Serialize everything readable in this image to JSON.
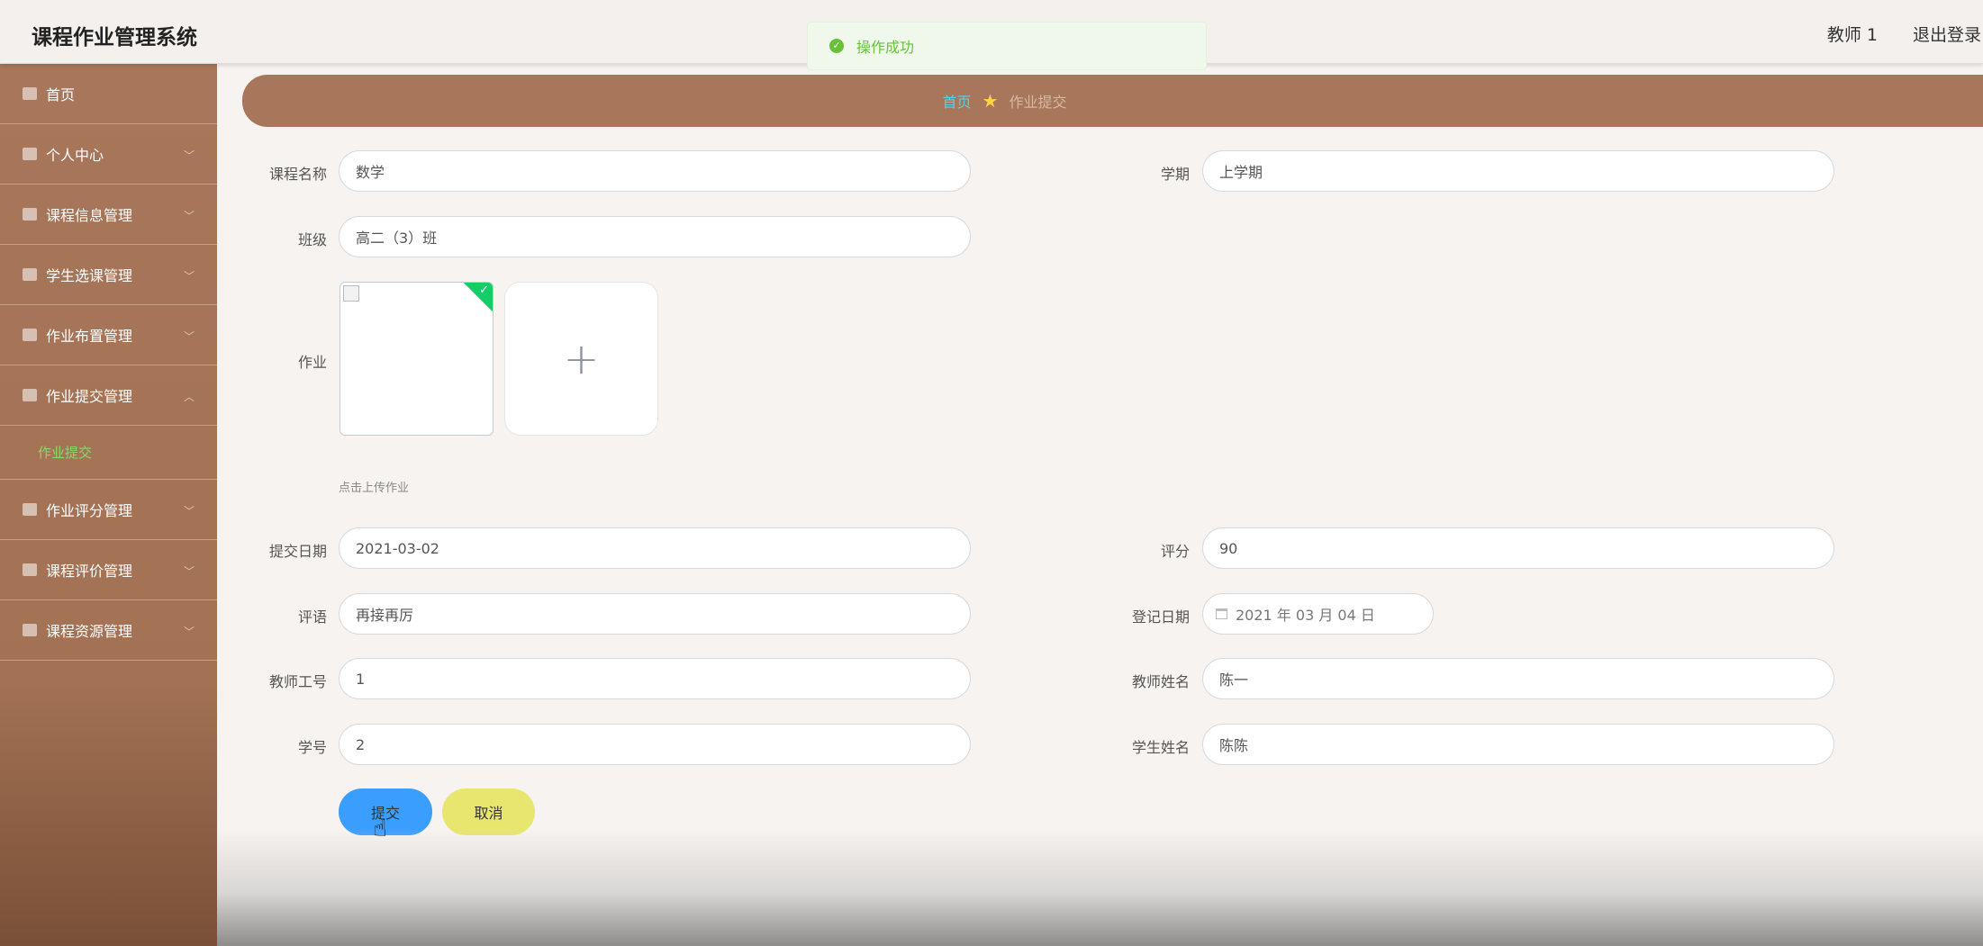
{
  "header": {
    "app_title": "课程作业管理系统",
    "user": "教师 1",
    "logout": "退出登录"
  },
  "toast": {
    "message": "操作成功"
  },
  "sidebar": {
    "items": [
      {
        "label": "首页",
        "icon": "home-icon",
        "expanded": false
      },
      {
        "label": "个人中心",
        "icon": "user-icon",
        "expanded": false
      },
      {
        "label": "课程信息管理",
        "icon": "monitor-icon",
        "expanded": false
      },
      {
        "label": "学生选课管理",
        "icon": "briefcase-icon",
        "expanded": false
      },
      {
        "label": "作业布置管理",
        "icon": "grid-icon",
        "expanded": false
      },
      {
        "label": "作业提交管理",
        "icon": "clipboard-icon",
        "expanded": true
      },
      {
        "label": "作业评分管理",
        "icon": "copy-icon",
        "expanded": false
      },
      {
        "label": "课程评价管理",
        "icon": "clipboard-icon",
        "expanded": false
      },
      {
        "label": "课程资源管理",
        "icon": "monitor-icon",
        "expanded": false
      }
    ],
    "submenu_active": "作业提交"
  },
  "breadcrumb": {
    "home": "首页",
    "current": "作业提交"
  },
  "form": {
    "course_name_label": "课程名称",
    "course_name": "数学",
    "semester_label": "学期",
    "semester": "上学期",
    "class_label": "班级",
    "class": "高二（3）班",
    "homework_label": "作业",
    "upload_hint": "点击上传作业",
    "upload_add": "+",
    "submit_date_label": "提交日期",
    "submit_date": "2021-03-02",
    "score_label": "评分",
    "score": "90",
    "comment_label": "评语",
    "comment": "再接再厉",
    "register_date_label": "登记日期",
    "register_date": "2021 年 03 月 04 日",
    "teacher_id_label": "教师工号",
    "teacher_id": "1",
    "teacher_name_label": "教师姓名",
    "teacher_name": "陈一",
    "student_id_label": "学号",
    "student_id": "2",
    "student_name_label": "学生姓名",
    "student_name": "陈陈"
  },
  "buttons": {
    "submit": "提交",
    "cancel": "取消"
  }
}
